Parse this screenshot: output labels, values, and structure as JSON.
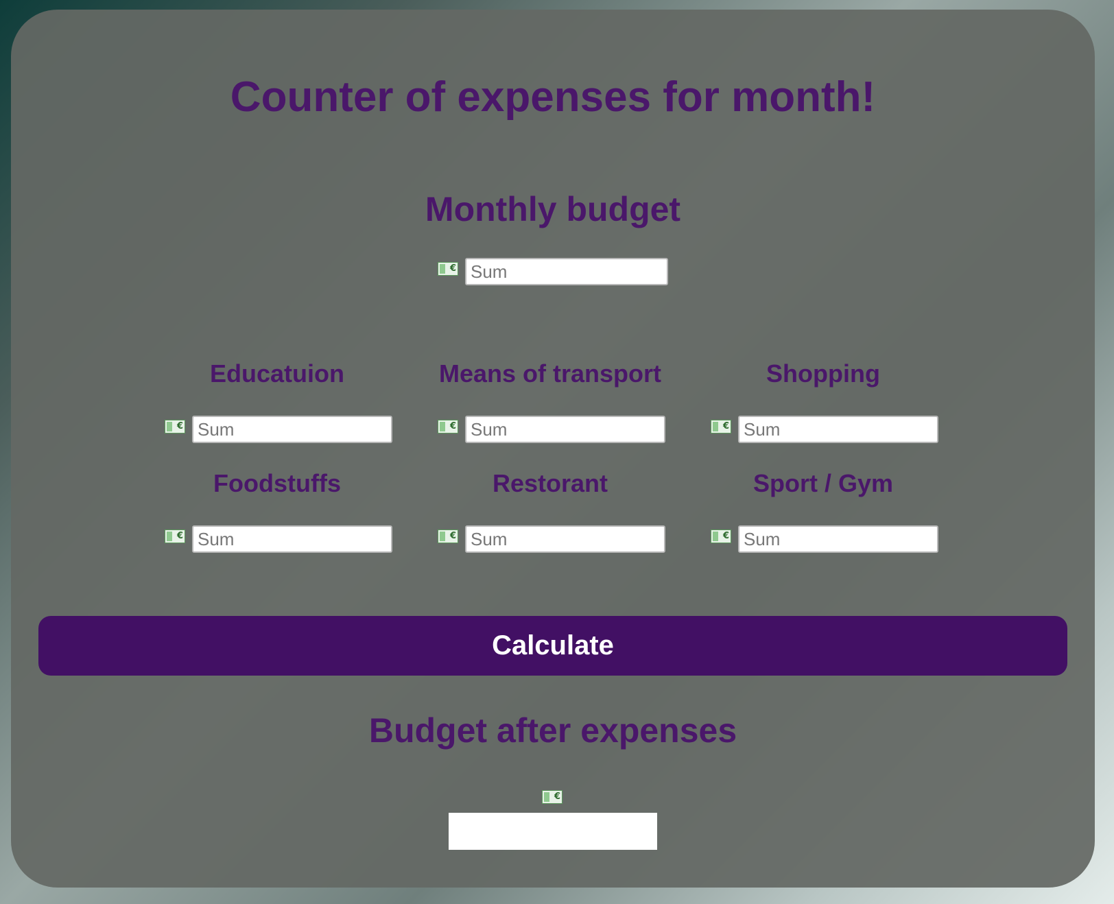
{
  "page": {
    "title": "Counter of expenses for month!",
    "budget_heading": "Monthly budget",
    "after_heading": "Budget after expenses"
  },
  "budget": {
    "placeholder": "Sum",
    "value": ""
  },
  "categories": [
    {
      "label": "Educatuion",
      "placeholder": "Sum"
    },
    {
      "label": "Means of transport",
      "placeholder": "Sum"
    },
    {
      "label": "Shopping",
      "placeholder": "Sum"
    },
    {
      "label": "Foodstuffs",
      "placeholder": "Sum"
    },
    {
      "label": "Restorant",
      "placeholder": "Sum"
    },
    {
      "label": "Sport / Gym",
      "placeholder": "Sum"
    }
  ],
  "calculate_label": "Calculate",
  "result": {
    "value": ""
  },
  "icons": {
    "money": "money-bill-euro-icon"
  },
  "colors": {
    "accent": "#421064",
    "heading": "#4a176a",
    "panel": "#646864"
  }
}
